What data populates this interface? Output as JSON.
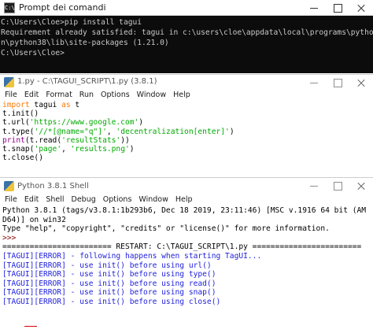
{
  "cmd": {
    "title": "Prompt dei comandi",
    "icon_text": "C:\\",
    "lines": [
      "C:\\Users\\Cloe>pip install tagui",
      "Requirement already satisfied: tagui in c:\\users\\cloe\\appdata\\local\\programs\\pytho",
      "n\\python38\\lib\\site-packages (1.21.0)",
      "",
      "C:\\Users\\Cloe>"
    ]
  },
  "editor": {
    "title": "1.py - C:\\TAGUI_SCRIPT\\1.py (3.8.1)",
    "menu": [
      "File",
      "Edit",
      "Format",
      "Run",
      "Options",
      "Window",
      "Help"
    ],
    "code": {
      "l1_kw1": "import",
      "l1_mod": " tagui ",
      "l1_kw2": "as",
      "l1_alias": " t",
      "l2": "t.init()",
      "l3_pre": "t.url(",
      "l3_str": "'https://www.google.com'",
      "l3_post": ")",
      "l4_pre": "t.type(",
      "l4_str1": "'//*[@name=\"q\"]'",
      "l4_mid": ", ",
      "l4_str2": "'decentralization[enter]'",
      "l4_post": ")",
      "l5_bi": "print",
      "l5_pre": "(t.read(",
      "l5_str": "'resultStats'",
      "l5_post": "))",
      "l6_pre": "t.snap(",
      "l6_str1": "'page'",
      "l6_mid": ", ",
      "l6_str2": "'results.png'",
      "l6_post": ")",
      "l7": "t.close()"
    }
  },
  "shell": {
    "title": "Python 3.8.1 Shell",
    "menu": [
      "File",
      "Edit",
      "Shell",
      "Debug",
      "Options",
      "Window",
      "Help"
    ],
    "banner": [
      "Python 3.8.1 (tags/v3.8.1:1b293b6, Dec 18 2019, 23:11:46) [MSC v.1916 64 bit (AM",
      "D64)] on win32",
      "Type \"help\", \"copyright\", \"credits\" or \"license()\" for more information."
    ],
    "prompt": ">>>",
    "restart": "======================== RESTART: C:\\TAGUI_SCRIPT\\1.py ========================",
    "errors": [
      "[TAGUI][ERROR] - following happens when starting TagUI...",
      "",
      "",
      "[TAGUI][ERROR] - use init() before using url()",
      "[TAGUI][ERROR] - use init() before using type()",
      "[TAGUI][ERROR] - use init() before using read()",
      "",
      "[TAGUI][ERROR] - use init() before using snap()",
      "[TAGUI][ERROR] - use init() before using close()"
    ]
  },
  "colors": {
    "keyword": "#ff7700",
    "builtin": "#900090",
    "string": "#00aa00",
    "error_output": "#1e1edc",
    "prompt": "#8b0000"
  }
}
